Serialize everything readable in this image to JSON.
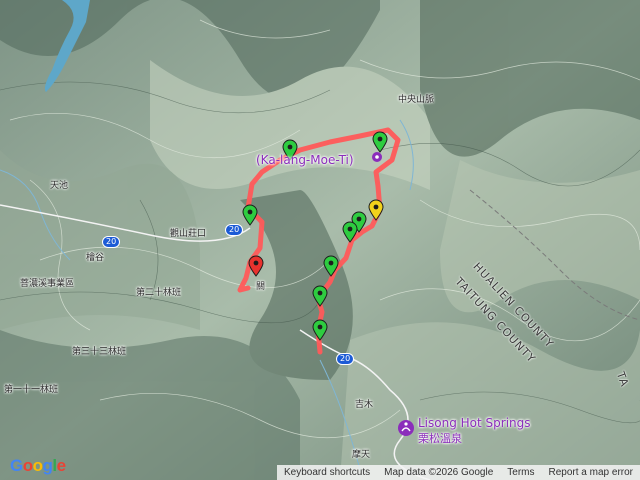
{
  "map": {
    "place_labels": [
      {
        "id": "zhongyang-range",
        "text": "中央山脈"
      },
      {
        "id": "tianchi",
        "text": "天池"
      },
      {
        "id": "mengshan",
        "text": "觀山莊口"
      },
      {
        "id": "kuigu",
        "text": "檜谷"
      },
      {
        "id": "work-station",
        "text": "菩濃溪事業區"
      },
      {
        "id": "forest-30",
        "text": "第二十林班"
      },
      {
        "id": "forest-32",
        "text": "第三十三林班"
      },
      {
        "id": "forest-11",
        "text": "第一十一林班"
      },
      {
        "id": "jimu",
        "text": "吉木"
      },
      {
        "id": "motian",
        "text": "摩天"
      },
      {
        "id": "guan",
        "text": "關"
      }
    ],
    "poi": {
      "kalamoeti": "(Ka-lang-Moe-Ti)",
      "lisong_en": "Lisong Hot Springs",
      "lisong_zh": "栗松溫泉"
    },
    "counties": {
      "hualien": "HUALIEN COUNTY",
      "taitung": "TAITUNG COUNTY",
      "edge": "TA"
    },
    "route_shields": [
      "20",
      "20",
      "20"
    ],
    "attribution": {
      "keyboard": "Keyboard shortcuts",
      "data": "Map data ©2026 Google",
      "terms": "Terms",
      "report": "Report a map error"
    },
    "logo": [
      "G",
      "o",
      "o",
      "g",
      "l",
      "e"
    ],
    "colors": {
      "route": "#ff5a5a",
      "marker_green": "#2ecc40",
      "marker_yellow": "#f2d21b",
      "marker_red": "#e8322e",
      "poi": "#8b2dbb",
      "water": "#5ea7c9"
    }
  }
}
